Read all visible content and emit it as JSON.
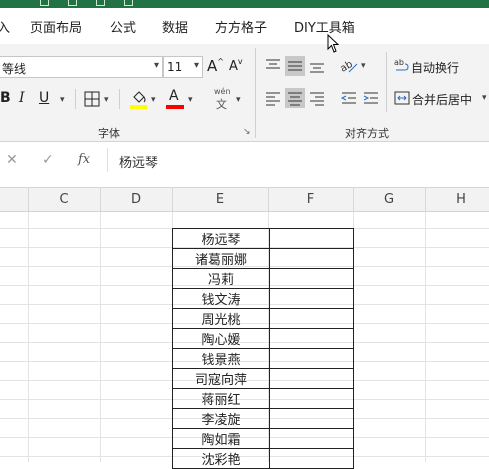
{
  "tabs": [
    "入",
    "页面布局",
    "公式",
    "数据",
    "方方格子",
    "DIY工具箱"
  ],
  "ribbon": {
    "font_name": "等线",
    "font_size": "11",
    "grow_font": "A",
    "shrink_font": "A",
    "bold": "B",
    "italic": "I",
    "underline": "U",
    "font_color_letter": "A",
    "phonetic": "wén",
    "phonetic_char": "文",
    "font_group_label": "字体",
    "wrap_text": "自动换行",
    "merge_center": "合并后居中",
    "align_group_label": "对齐方式",
    "colors": {
      "highlight": "#ffff00",
      "font_color": "#ff0000",
      "accent": "#217346"
    }
  },
  "formula_bar": {
    "cancel": "✕",
    "enter": "✓",
    "fx": "fx",
    "value": "杨远琴"
  },
  "columns": [
    "C",
    "D",
    "E",
    "F",
    "G",
    "H"
  ],
  "names": [
    "杨远琴",
    "诸葛丽娜",
    "冯莉",
    "钱文涛",
    "周光桃",
    "陶心媛",
    "钱景燕",
    "司寇向萍",
    "蒋丽红",
    "李凌旋",
    "陶如霜",
    "沈彩艳"
  ]
}
